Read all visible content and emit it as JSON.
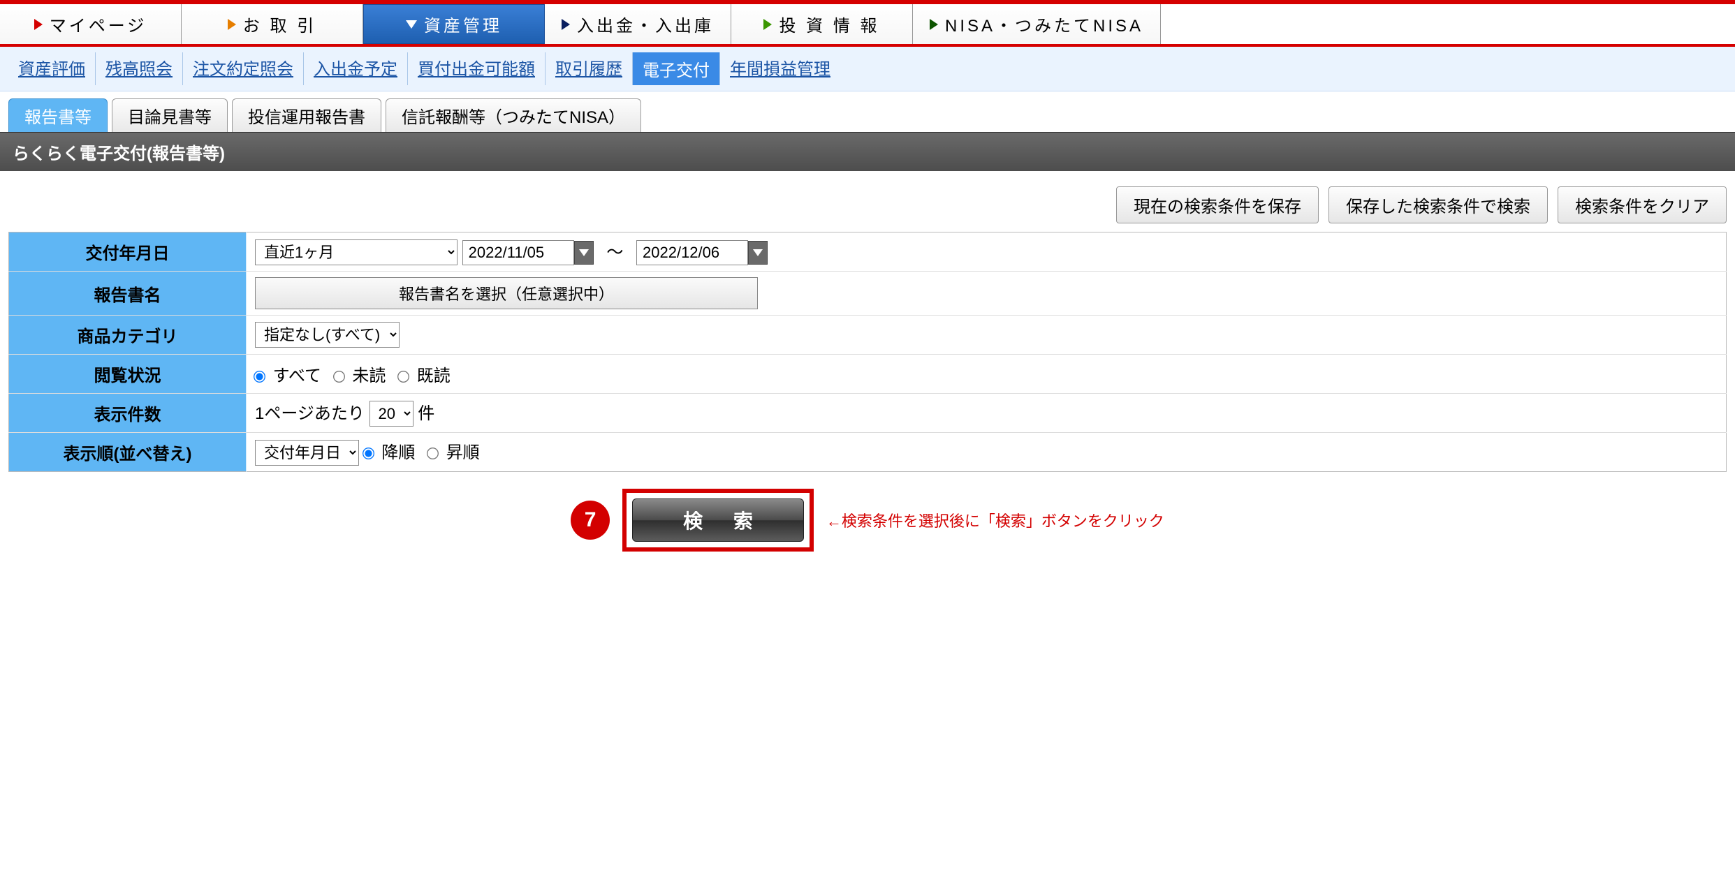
{
  "mainNav": [
    {
      "label": "マイページ",
      "triClass": "tri-right-red",
      "active": false
    },
    {
      "label": "お 取 引",
      "triClass": "tri-right-orange",
      "active": false
    },
    {
      "label": "資産管理",
      "triClass": "tri-down-white",
      "active": true
    },
    {
      "label": "入出金・入出庫",
      "triClass": "tri-right-darkblue",
      "active": false
    },
    {
      "label": "投 資 情 報",
      "triClass": "tri-right-green",
      "active": false
    },
    {
      "label": "NISA・つみたてNISA",
      "triClass": "tri-right-darkgreen",
      "active": false
    }
  ],
  "subNav": [
    {
      "label": "資産評価",
      "active": false
    },
    {
      "label": "残高照会",
      "active": false
    },
    {
      "label": "注文約定照会",
      "active": false
    },
    {
      "label": "入出金予定",
      "active": false
    },
    {
      "label": "買付出金可能額",
      "active": false
    },
    {
      "label": "取引履歴",
      "active": false
    },
    {
      "label": "電子交付",
      "active": true
    },
    {
      "label": "年間損益管理",
      "active": false
    }
  ],
  "tabs": [
    {
      "label": "報告書等",
      "active": true
    },
    {
      "label": "目論見書等",
      "active": false
    },
    {
      "label": "投信運用報告書",
      "active": false
    },
    {
      "label": "信託報酬等（つみたてNISA）",
      "active": false
    }
  ],
  "pageTitle": "らくらく電子交付(報告書等)",
  "actions": {
    "save": "現在の検索条件を保存",
    "load": "保存した検索条件で検索",
    "clear": "検索条件をクリア"
  },
  "form": {
    "row1": {
      "label": "交付年月日",
      "range": "直近1ヶ月",
      "from": "2022/11/05",
      "to": "2022/12/06",
      "tilde": "～"
    },
    "row2": {
      "label": "報告書名",
      "button": "報告書名を選択（任意選択中）"
    },
    "row3": {
      "label": "商品カテゴリ",
      "select": "指定なし(すべて)"
    },
    "row4": {
      "label": "閲覧状況",
      "opt1": "すべて",
      "opt2": "未読",
      "opt3": "既読"
    },
    "row5": {
      "label": "表示件数",
      "prefix": "1ページあたり",
      "count": "20",
      "suffix": "件"
    },
    "row6": {
      "label": "表示順(並べ替え)",
      "select": "交付年月日",
      "opt1": "降順",
      "opt2": "昇順"
    }
  },
  "search": {
    "step": "7",
    "button": "検 索",
    "hint": "←検索条件を選択後に「検索」ボタンをクリック"
  }
}
